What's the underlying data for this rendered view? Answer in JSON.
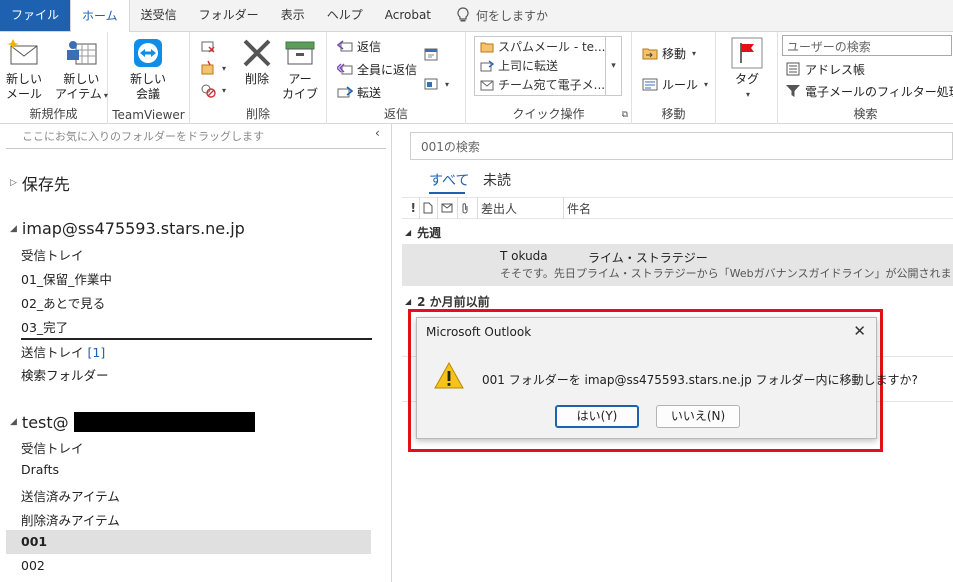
{
  "tabs": [
    {
      "label": "ファイル"
    },
    {
      "label": "ホーム"
    },
    {
      "label": "送受信"
    },
    {
      "label": "フォルダー"
    },
    {
      "label": "表示"
    },
    {
      "label": "ヘルプ"
    },
    {
      "label": "Acrobat"
    }
  ],
  "tell_me": "何をしますか",
  "ribbon": {
    "new_mail": "新しい\nメール",
    "new_item": "新しい\nアイテム",
    "group_new": "新規作成",
    "new_meeting": "新しい\n会議",
    "group_teamviewer": "TeamViewer",
    "delete": "削除",
    "archive": "アー\nカイブ",
    "group_delete": "削除",
    "reply": "返信",
    "reply_all": "全員に返信",
    "forward": "転送",
    "group_reply": "返信",
    "quick_steps": [
      "スパムメール - te...",
      "上司に転送",
      "チーム宛て電子メ..."
    ],
    "group_quick": "クイック操作",
    "move": "移動",
    "rules": "ルール",
    "group_move": "移動",
    "tags": "タグ",
    "user_search_placeholder": "ユーザーの検索",
    "address_book": "アドレス帳",
    "filter_email": "電子メールのフィルター処理",
    "group_search": "検索"
  },
  "folders": {
    "fav_hint": "ここにお気に入りのフォルダーをドラッグします",
    "saved": "保存先",
    "account1": "imap@ss475593.stars.ne.jp",
    "account1_items": [
      "受信トレイ",
      "01_保留_作業中",
      "02_あとで見る",
      "03_完了"
    ],
    "outbox": "送信トレイ",
    "outbox_count": "[1]",
    "search_folder": "検索フォルダー",
    "account2": "test@",
    "account2_items": [
      "受信トレイ",
      "Drafts",
      "送信済みアイテム",
      "削除済みアイテム"
    ],
    "selected": "001",
    "last": "002"
  },
  "mail": {
    "search_placeholder": "001の検索",
    "filter_all": "すべて",
    "filter_unread": "未読",
    "col_from": "差出人",
    "col_subject": "件名",
    "group1": "先週",
    "row_from": "T okuda",
    "row_subject": "ライム・ストラテジー",
    "row_preview": "そそです。先日プライム・ストラテジーから「Webガバナンスガイドライン」が公開されました。 こちらは",
    "group2": "2 か月前以前"
  },
  "dialog": {
    "title": "Microsoft Outlook",
    "message": "001 フォルダーを imap@ss475593.stars.ne.jp フォルダー内に移動しますか?",
    "yes": "はい(Y)",
    "no": "いいえ(N)"
  }
}
